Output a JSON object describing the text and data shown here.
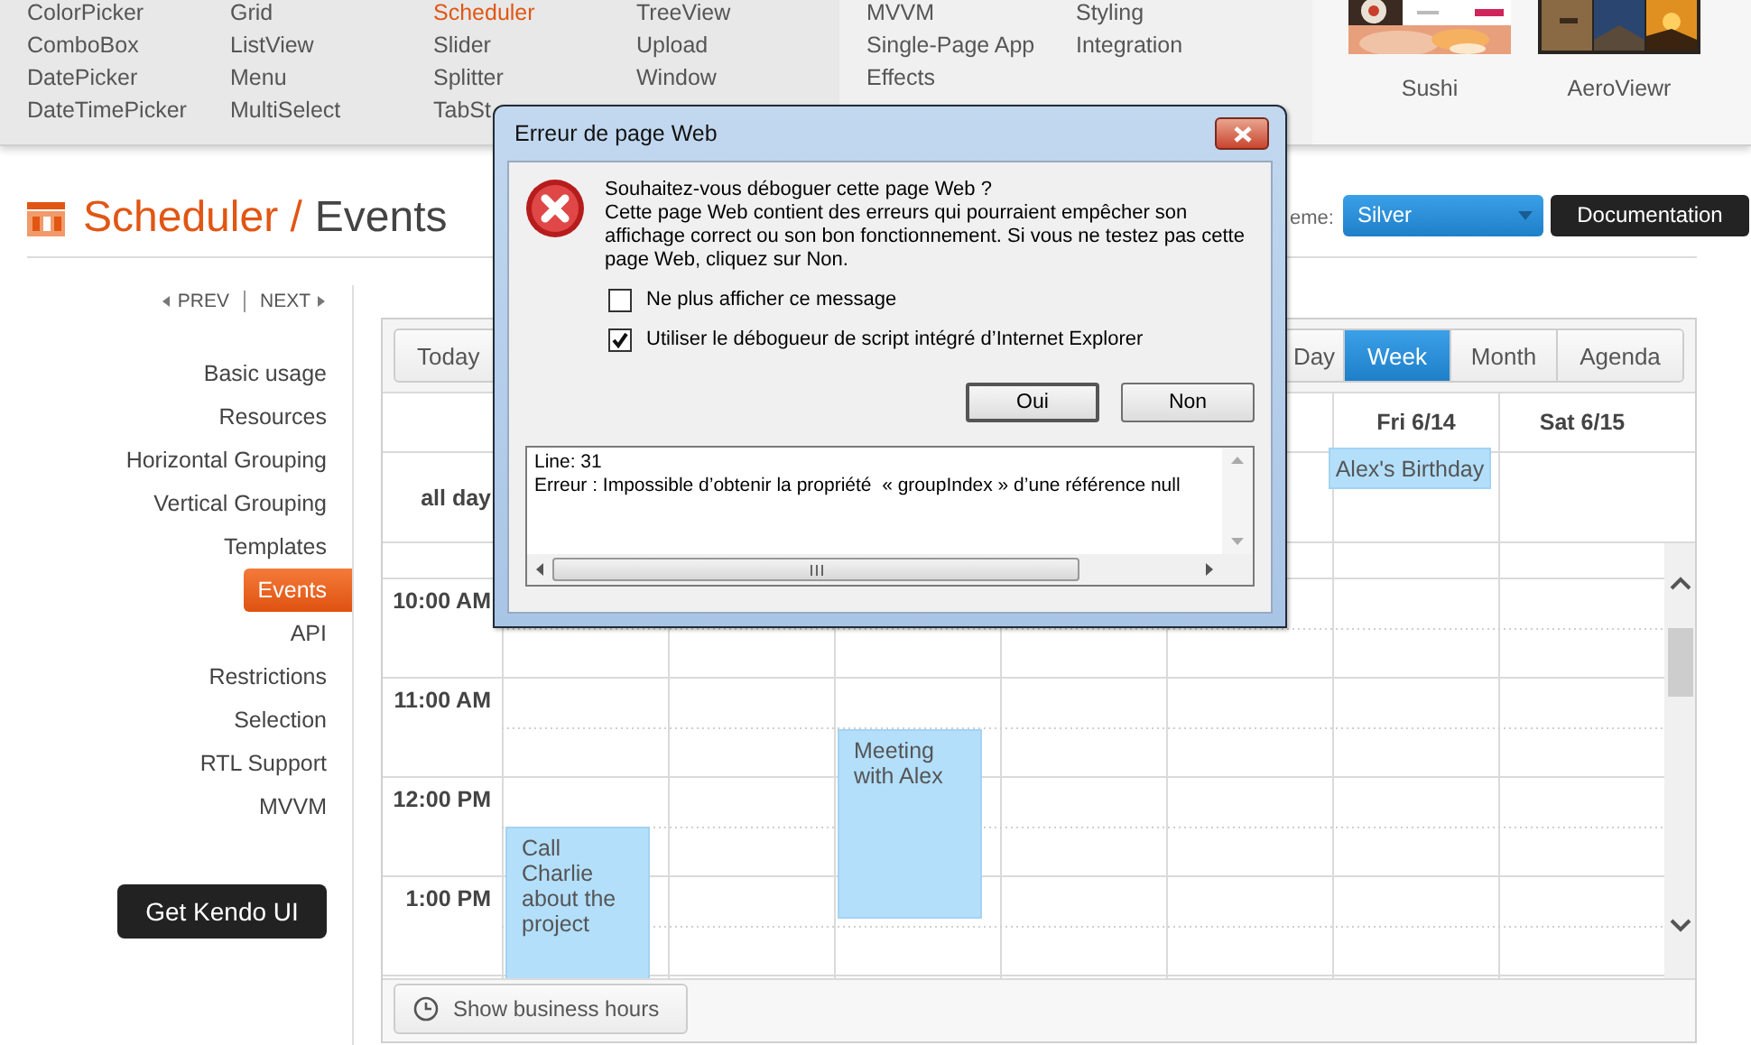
{
  "nav": {
    "panels": [
      {
        "columns": [
          [
            {
              "label": "ColorPicker",
              "selected": false
            },
            {
              "label": "ComboBox",
              "selected": false
            },
            {
              "label": "DatePicker",
              "selected": false
            },
            {
              "label": "DateTimePicker",
              "selected": false
            }
          ],
          [
            {
              "label": "Grid",
              "selected": false
            },
            {
              "label": "ListView",
              "selected": false
            },
            {
              "label": "Menu",
              "selected": false
            },
            {
              "label": "MultiSelect",
              "selected": false
            }
          ],
          [
            {
              "label": "Scheduler",
              "selected": true
            },
            {
              "label": "Slider",
              "selected": false
            },
            {
              "label": "Splitter",
              "selected": false
            },
            {
              "label": "TabSt",
              "selected": false
            }
          ],
          [
            {
              "label": "TreeView",
              "selected": false
            },
            {
              "label": "Upload",
              "selected": false
            },
            {
              "label": "Window",
              "selected": false
            }
          ]
        ]
      },
      {
        "columns": [
          [
            {
              "label": "MVVM",
              "selected": false
            },
            {
              "label": "Single-Page App",
              "selected": false
            },
            {
              "label": "Effects",
              "selected": false
            }
          ],
          [
            {
              "label": "Styling",
              "selected": false
            },
            {
              "label": "Integration",
              "selected": false
            }
          ]
        ]
      }
    ]
  },
  "showcase": [
    {
      "label": "Sushi",
      "kind": "picture"
    },
    {
      "label": "AeroViewr",
      "kind": "picture"
    }
  ],
  "page_title": {
    "section": "Scheduler /",
    "page": "Events"
  },
  "theme": {
    "label": "eme:",
    "value": "Silver"
  },
  "documentation_button": "Documentation",
  "pager": {
    "prev": "PREV",
    "next": "NEXT"
  },
  "sidebar": {
    "items": [
      {
        "label": "Basic usage",
        "selected": false
      },
      {
        "label": "Resources",
        "selected": false
      },
      {
        "label": "Horizontal Grouping",
        "selected": false
      },
      {
        "label": "Vertical Grouping",
        "selected": false
      },
      {
        "label": "Templates",
        "selected": false
      },
      {
        "label": "Events",
        "selected": true
      },
      {
        "label": "API",
        "selected": false
      },
      {
        "label": "Restrictions",
        "selected": false
      },
      {
        "label": "Selection",
        "selected": false
      },
      {
        "label": "RTL Support",
        "selected": false
      },
      {
        "label": "MVVM",
        "selected": false
      }
    ]
  },
  "cta_button": "Get Kendo UI",
  "scheduler": {
    "today_button": "Today",
    "views": [
      {
        "label": "Day",
        "selected": false
      },
      {
        "label": "Week",
        "selected": true
      },
      {
        "label": "Month",
        "selected": false
      },
      {
        "label": "Agenda",
        "selected": false
      }
    ],
    "day_headers": [
      "Fri 6/14",
      "Sat 6/15"
    ],
    "all_day_label": "all day",
    "all_day_events": [
      {
        "title": "Alex's Birthday"
      }
    ],
    "time_slots": [
      "10:00 AM",
      "11:00 AM",
      "12:00 PM",
      "1:00 PM"
    ],
    "events": [
      {
        "title": "Meeting with Alex"
      },
      {
        "title": "Call Charlie about the project"
      }
    ],
    "footer_button": "Show business hours"
  },
  "dialog": {
    "title": "Erreur de page Web",
    "question": "Souhaitez-vous déboguer cette page Web ?",
    "message": "Cette page Web contient des erreurs qui pourraient empêcher son affichage correct ou son bon fonctionnement. Si vous ne testez pas cette page Web, cliquez sur Non.",
    "options": [
      {
        "label": "Ne plus afficher ce message",
        "checked": false
      },
      {
        "label": "Utiliser le débogueur de script intégré d’Internet Explorer",
        "checked": true
      }
    ],
    "buttons": [
      "Oui",
      "Non"
    ],
    "details": [
      "Line: 31",
      "Erreur : Impossible d’obtenir la propriété  « groupIndex » d’une référence null"
    ]
  }
}
